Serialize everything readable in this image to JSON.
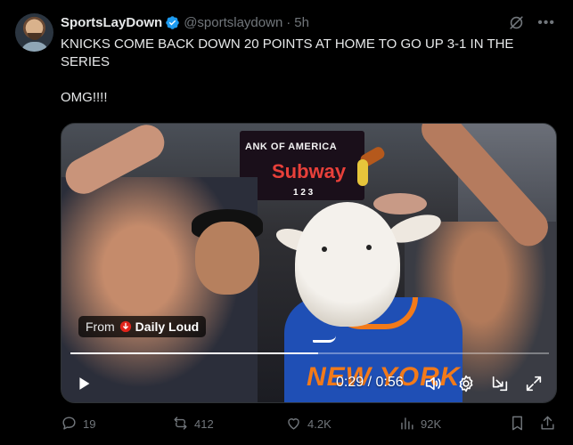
{
  "author": {
    "display_name": "SportsLayDown",
    "handle": "@sportslaydown",
    "separator": "·",
    "time": "5h",
    "verified": true
  },
  "tweet": {
    "text": "KNICKS COME BACK DOWN 20 POINTS AT HOME TO GO UP 3-1 IN THE SERIES\n\nOMG!!!!"
  },
  "media": {
    "scene_text": {
      "sign_line1": "ANK OF AMERICA",
      "sign_line2": "Subway",
      "sign_lines": "1 2 3",
      "jersey": "NEW YORK"
    },
    "from_label": "From",
    "from_name": "Daily Loud",
    "time_readout": "0:29 / 0:56",
    "progress": 0.5179
  },
  "actions": {
    "replies": "19",
    "reposts": "412",
    "likes": "4.2K",
    "views": "92K"
  },
  "icons": {
    "header": [
      "grok-icon",
      "more-icon"
    ],
    "video": [
      "play-icon",
      "volume-icon",
      "settings-icon",
      "pip-icon",
      "fullscreen-icon"
    ],
    "actions": [
      "reply-icon",
      "repost-icon",
      "like-icon",
      "views-icon",
      "bookmark-icon",
      "share-icon"
    ]
  },
  "colors": {
    "background": "#000000",
    "text": "#e7e9ea",
    "muted": "#71767b",
    "verified": "#1d9bf0",
    "knicks_blue": "#1f4fb5",
    "knicks_orange": "#f27a1a"
  }
}
